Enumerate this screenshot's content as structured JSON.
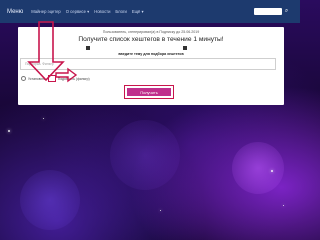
{
  "nav": {
    "brand": "Меню",
    "items": [
      "Майнер эцетер",
      "О сервисе ▾",
      "Новости",
      "Блоги",
      "Ещё ▾"
    ]
  },
  "panel": {
    "note": "Пользователь, сгенерировал(а) в Подписку до 25.06.2019",
    "headline": "Получите список хештегов в течение 1 минуты!",
    "section_title": "введите тему для подбора хештегов",
    "input_placeholder": "Подборка. Фильтр",
    "option_a": "Установить",
    "option_b": "Подобрать (фильтр)",
    "submit_label": "Получить"
  },
  "colors": {
    "navbar": "#1d3a6e",
    "annotation": "#c8154c",
    "button": "#c02f8c"
  }
}
